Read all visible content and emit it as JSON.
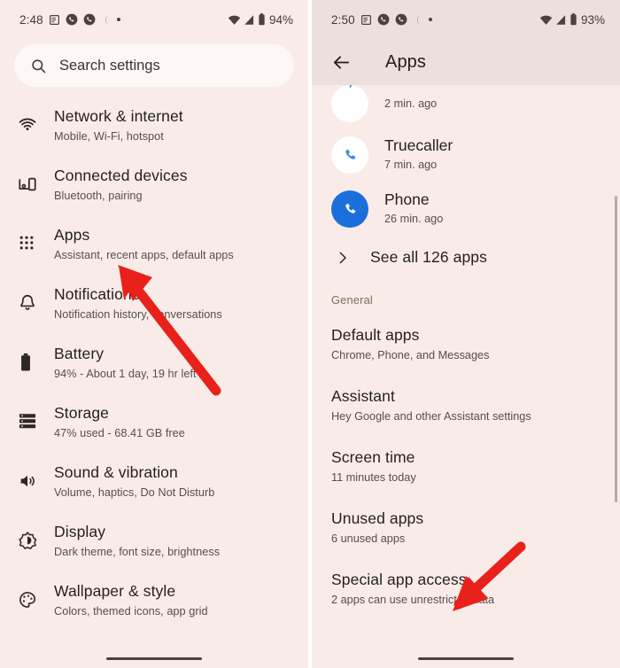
{
  "left_phone": {
    "status_bar": {
      "time": "2:48",
      "battery_percent": "94%",
      "icons": [
        "note-icon",
        "phone-call-icon",
        "phone-call-icon",
        "crescent-moon-icon",
        "dot-icon",
        "wifi-icon",
        "signal-icon",
        "battery-icon"
      ]
    },
    "search": {
      "placeholder": "Search settings",
      "icon": "search-icon"
    },
    "items": [
      {
        "icon": "wifi-icon",
        "title": "Network & internet",
        "subtitle": "Mobile, Wi-Fi, hotspot"
      },
      {
        "icon": "connected-devices-icon",
        "title": "Connected devices",
        "subtitle": "Bluetooth, pairing"
      },
      {
        "icon": "apps-grid-icon",
        "title": "Apps",
        "subtitle": "Assistant, recent apps, default apps"
      },
      {
        "icon": "bell-icon",
        "title": "Notifications",
        "subtitle": "Notification history, conversations"
      },
      {
        "icon": "battery-icon",
        "title": "Battery",
        "subtitle": "94% - About 1 day, 19 hr left"
      },
      {
        "icon": "storage-icon",
        "title": "Storage",
        "subtitle": "47% used - 68.41 GB free"
      },
      {
        "icon": "volume-icon",
        "title": "Sound & vibration",
        "subtitle": "Volume, haptics, Do Not Disturb"
      },
      {
        "icon": "brightness-icon",
        "title": "Display",
        "subtitle": "Dark theme, font size, brightness"
      },
      {
        "icon": "palette-icon",
        "title": "Wallpaper & style",
        "subtitle": "Colors, themed icons, app grid"
      }
    ]
  },
  "right_phone": {
    "status_bar": {
      "time": "2:50",
      "battery_percent": "93%"
    },
    "app_bar": {
      "back_icon": "back-arrow-icon",
      "title": "Apps"
    },
    "recent_apps": [
      {
        "icon": "truecaller-partial-icon",
        "name": "",
        "time": "2 min. ago",
        "color": "#1f6fd0"
      },
      {
        "icon": "truecaller-icon",
        "name": "Truecaller",
        "time": "7 min. ago",
        "color": "#2a7ee0"
      },
      {
        "icon": "phone-icon",
        "name": "Phone",
        "time": "26 min. ago",
        "color": "#1a73e8"
      }
    ],
    "see_all": {
      "icon": "chevron-right-icon",
      "label": "See all 126 apps"
    },
    "section_header": "General",
    "preferences": [
      {
        "title": "Default apps",
        "subtitle": "Chrome, Phone, and Messages"
      },
      {
        "title": "Assistant",
        "subtitle": "Hey Google and other Assistant settings"
      },
      {
        "title": "Screen time",
        "subtitle": "11 minutes today"
      },
      {
        "title": "Unused apps",
        "subtitle": "6 unused apps"
      },
      {
        "title": "Special app access",
        "subtitle": "2 apps can use unrestricted data"
      }
    ]
  },
  "annotations": {
    "arrow_color": "#e8221a",
    "arrows": [
      {
        "name": "arrow-pointing-to-apps",
        "target": "Apps"
      },
      {
        "name": "arrow-pointing-to-special-app-access",
        "target": "Special app access"
      }
    ]
  },
  "theme": {
    "background": "#f9ece8",
    "tinted_bar": "#ede0dc",
    "search_field": "#fdf7f5",
    "title_text": "#231f1e",
    "subtitle_text": "#564e4c",
    "section_text": "#7c6f5f"
  }
}
